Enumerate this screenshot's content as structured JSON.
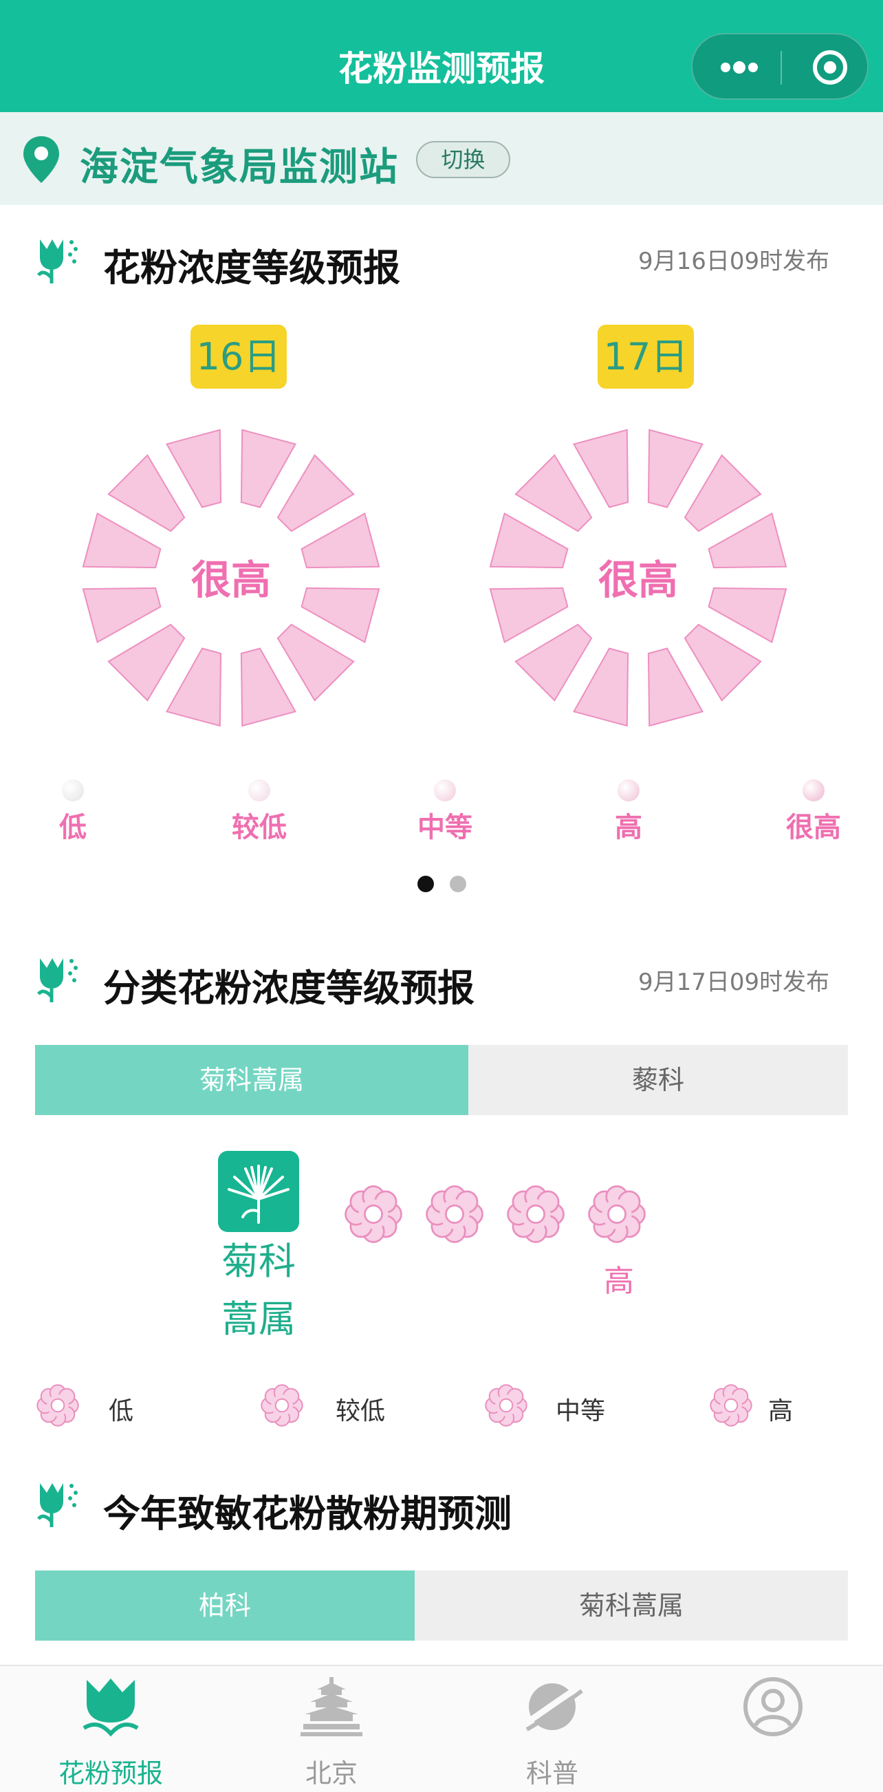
{
  "header": {
    "title": "花粉监测预报"
  },
  "station": {
    "name": "海淀气象局监测站",
    "switch_label": "切换"
  },
  "forecast": {
    "title": "花粉浓度等级预报",
    "published": "9月16日09时发布",
    "days": [
      {
        "label": "16日",
        "level": "很高"
      },
      {
        "label": "17日",
        "level": "很高"
      }
    ],
    "legend": [
      "低",
      "较低",
      "中等",
      "高",
      "很高"
    ]
  },
  "category": {
    "title": "分类花粉浓度等级预报",
    "published": "9月17日09时发布",
    "tabs": [
      "菊科蒿属",
      "藜科"
    ],
    "plant": {
      "name_line1": "菊科",
      "name_line2": "蒿属",
      "level": "高",
      "level_count": 4
    },
    "legend": [
      "低",
      "较低",
      "中等",
      "高"
    ]
  },
  "season": {
    "title": "今年致敏花粉散粉期预测",
    "tabs": [
      "柏科",
      "菊科蒿属"
    ]
  },
  "nav": {
    "items": [
      "花粉预报",
      "北京",
      "科普",
      ""
    ]
  },
  "colors": {
    "brand": "#14bf9b",
    "pink": "#ef6fb0",
    "badge": "#f6d42a"
  }
}
